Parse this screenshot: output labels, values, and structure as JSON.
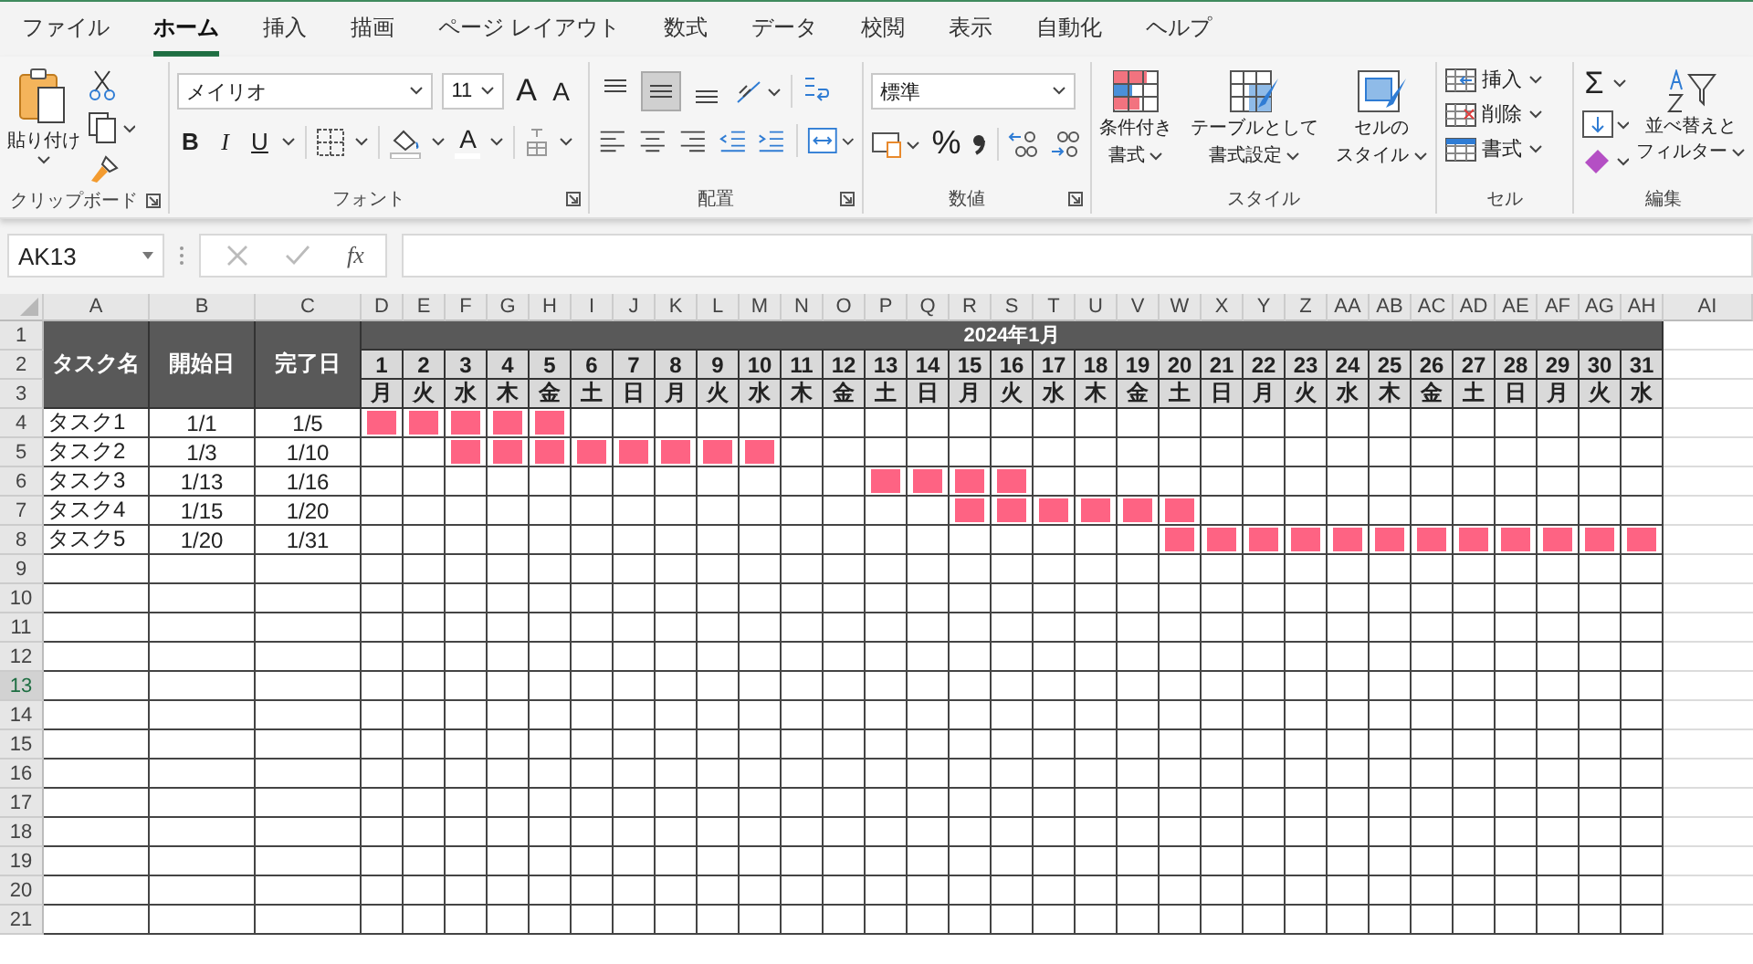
{
  "ribbon_tabs": [
    {
      "label": "ファイル",
      "selected": false
    },
    {
      "label": "ホーム",
      "selected": true
    },
    {
      "label": "挿入",
      "selected": false
    },
    {
      "label": "描画",
      "selected": false
    },
    {
      "label": "ページ レイアウト",
      "selected": false
    },
    {
      "label": "数式",
      "selected": false
    },
    {
      "label": "データ",
      "selected": false
    },
    {
      "label": "校閲",
      "selected": false
    },
    {
      "label": "表示",
      "selected": false
    },
    {
      "label": "自動化",
      "selected": false
    },
    {
      "label": "ヘルプ",
      "selected": false
    }
  ],
  "clipboard": {
    "paste": "貼り付け",
    "label": "クリップボード"
  },
  "font": {
    "name": "メイリオ",
    "size": "11",
    "grow": "A",
    "shrink": "A",
    "bold": "B",
    "italic": "I",
    "underline": "U",
    "font_color_glyph": "A",
    "label": "フォント"
  },
  "alignment": {
    "vertical": [
      {
        "kind": "top",
        "selected": false
      },
      {
        "kind": "middle",
        "selected": true
      },
      {
        "kind": "bottom",
        "selected": false
      }
    ],
    "label": "配置"
  },
  "number": {
    "format": "標準",
    "percent": "%",
    "label": "数値"
  },
  "styles": {
    "buttons": [
      {
        "kind": "conditional",
        "line1": "条件付き",
        "line2": "書式"
      },
      {
        "kind": "table",
        "line1": "テーブルとして",
        "line2": "書式設定"
      },
      {
        "kind": "cell",
        "line1": "セルの",
        "line2": "スタイル"
      }
    ],
    "label": "スタイル"
  },
  "cells": {
    "buttons": [
      {
        "kind": "insert",
        "label": "挿入"
      },
      {
        "kind": "delete",
        "label": "削除"
      },
      {
        "kind": "format",
        "label": "書式"
      }
    ],
    "label": "セル"
  },
  "editing": {
    "sum": "Σ",
    "sort_line1": "並べ替えと",
    "sort_line2": "フィルター",
    "label": "編集"
  },
  "formula_bar": {
    "name_box": "AK13",
    "fx": "fx"
  },
  "sheet": {
    "column_headers": [
      "A",
      "B",
      "C",
      "D",
      "E",
      "F",
      "G",
      "H",
      "I",
      "J",
      "K",
      "L",
      "M",
      "N",
      "O",
      "P",
      "Q",
      "R",
      "S",
      "T",
      "U",
      "V",
      "W",
      "X",
      "Y",
      "Z",
      "AA",
      "AB",
      "AC",
      "AD",
      "AE",
      "AF",
      "AG",
      "AH",
      "AI"
    ],
    "row_headers": [
      {
        "label": "1",
        "selected": false
      },
      {
        "label": "2",
        "selected": false
      },
      {
        "label": "3",
        "selected": false
      },
      {
        "label": "4",
        "selected": false
      },
      {
        "label": "5",
        "selected": false
      },
      {
        "label": "6",
        "selected": false
      },
      {
        "label": "7",
        "selected": false
      },
      {
        "label": "8",
        "selected": false
      },
      {
        "label": "9",
        "selected": false
      },
      {
        "label": "10",
        "selected": false
      },
      {
        "label": "11",
        "selected": false
      },
      {
        "label": "12",
        "selected": false
      },
      {
        "label": "13",
        "selected": true
      },
      {
        "label": "14",
        "selected": false
      },
      {
        "label": "15",
        "selected": false
      },
      {
        "label": "16",
        "selected": false
      },
      {
        "label": "17",
        "selected": false
      },
      {
        "label": "18",
        "selected": false
      },
      {
        "label": "19",
        "selected": false
      },
      {
        "label": "20",
        "selected": false
      },
      {
        "label": "21",
        "selected": false
      }
    ],
    "header": {
      "task": "タスク名",
      "start": "開始日",
      "end": "完了日",
      "month": "2024年1月"
    },
    "days": [
      {
        "day": "1",
        "weekday": "月"
      },
      {
        "day": "2",
        "weekday": "火"
      },
      {
        "day": "3",
        "weekday": "水"
      },
      {
        "day": "4",
        "weekday": "木"
      },
      {
        "day": "5",
        "weekday": "金"
      },
      {
        "day": "6",
        "weekday": "土"
      },
      {
        "day": "7",
        "weekday": "日"
      },
      {
        "day": "8",
        "weekday": "月"
      },
      {
        "day": "9",
        "weekday": "火"
      },
      {
        "day": "10",
        "weekday": "水"
      },
      {
        "day": "11",
        "weekday": "木"
      },
      {
        "day": "12",
        "weekday": "金"
      },
      {
        "day": "13",
        "weekday": "土"
      },
      {
        "day": "14",
        "weekday": "日"
      },
      {
        "day": "15",
        "weekday": "月"
      },
      {
        "day": "16",
        "weekday": "火"
      },
      {
        "day": "17",
        "weekday": "水"
      },
      {
        "day": "18",
        "weekday": "木"
      },
      {
        "day": "19",
        "weekday": "金"
      },
      {
        "day": "20",
        "weekday": "土"
      },
      {
        "day": "21",
        "weekday": "日"
      },
      {
        "day": "22",
        "weekday": "月"
      },
      {
        "day": "23",
        "weekday": "火"
      },
      {
        "day": "24",
        "weekday": "水"
      },
      {
        "day": "25",
        "weekday": "木"
      },
      {
        "day": "26",
        "weekday": "金"
      },
      {
        "day": "27",
        "weekday": "土"
      },
      {
        "day": "28",
        "weekday": "日"
      },
      {
        "day": "29",
        "weekday": "月"
      },
      {
        "day": "30",
        "weekday": "火"
      },
      {
        "day": "31",
        "weekday": "水"
      }
    ],
    "tasks": [
      {
        "name": "タスク1",
        "start": "1/1",
        "end": "1/5",
        "marks": [
          true,
          true,
          true,
          true,
          true,
          false,
          false,
          false,
          false,
          false,
          false,
          false,
          false,
          false,
          false,
          false,
          false,
          false,
          false,
          false,
          false,
          false,
          false,
          false,
          false,
          false,
          false,
          false,
          false,
          false,
          false
        ]
      },
      {
        "name": "タスク2",
        "start": "1/3",
        "end": "1/10",
        "marks": [
          false,
          false,
          true,
          true,
          true,
          true,
          true,
          true,
          true,
          true,
          false,
          false,
          false,
          false,
          false,
          false,
          false,
          false,
          false,
          false,
          false,
          false,
          false,
          false,
          false,
          false,
          false,
          false,
          false,
          false,
          false
        ]
      },
      {
        "name": "タスク3",
        "start": "1/13",
        "end": "1/16",
        "marks": [
          false,
          false,
          false,
          false,
          false,
          false,
          false,
          false,
          false,
          false,
          false,
          false,
          true,
          true,
          true,
          true,
          false,
          false,
          false,
          false,
          false,
          false,
          false,
          false,
          false,
          false,
          false,
          false,
          false,
          false,
          false
        ]
      },
      {
        "name": "タスク4",
        "start": "1/15",
        "end": "1/20",
        "marks": [
          false,
          false,
          false,
          false,
          false,
          false,
          false,
          false,
          false,
          false,
          false,
          false,
          false,
          false,
          true,
          true,
          true,
          true,
          true,
          true,
          false,
          false,
          false,
          false,
          false,
          false,
          false,
          false,
          false,
          false,
          false
        ]
      },
      {
        "name": "タスク5",
        "start": "1/20",
        "end": "1/31",
        "marks": [
          false,
          false,
          false,
          false,
          false,
          false,
          false,
          false,
          false,
          false,
          false,
          false,
          false,
          false,
          false,
          false,
          false,
          false,
          false,
          true,
          true,
          true,
          true,
          true,
          true,
          true,
          true,
          true,
          true,
          true,
          true
        ]
      }
    ]
  }
}
